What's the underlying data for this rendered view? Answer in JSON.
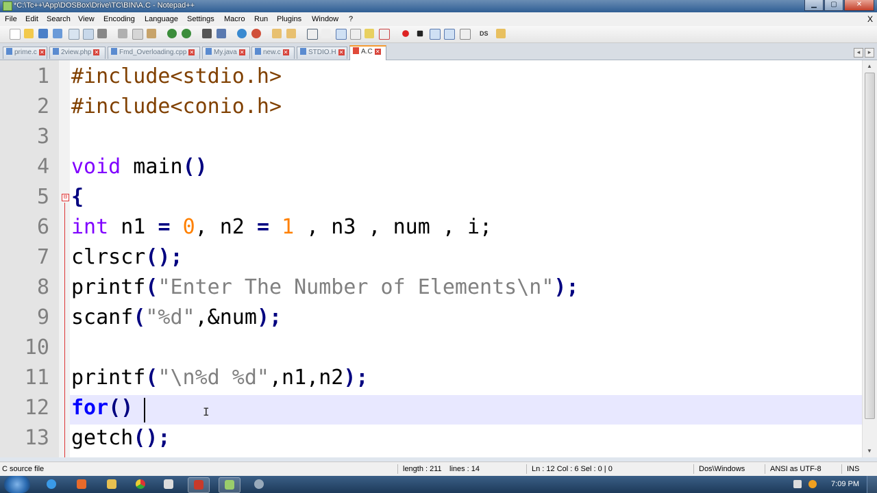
{
  "window": {
    "title": "*C:\\Tc++\\App\\DOSBox\\Drive\\TC\\BIN\\A.C - Notepad++",
    "close_label": "X"
  },
  "menu": [
    {
      "label": "File"
    },
    {
      "label": "Edit"
    },
    {
      "label": "Search"
    },
    {
      "label": "View"
    },
    {
      "label": "Encoding"
    },
    {
      "label": "Language"
    },
    {
      "label": "Settings"
    },
    {
      "label": "Macro"
    },
    {
      "label": "Run"
    },
    {
      "label": "Plugins"
    },
    {
      "label": "Window"
    },
    {
      "label": "?"
    }
  ],
  "toolbar": {
    "icons": [
      "new-file",
      "open-file",
      "save",
      "save-all",
      "close",
      "close-all",
      "print",
      "cut",
      "copy",
      "paste",
      "undo",
      "redo",
      "find",
      "replace",
      "zoom-in",
      "zoom-out",
      "sync-scroll-v",
      "sync-scroll-h",
      "word-wrap",
      "show-all-chars",
      "indent-guide",
      "user-language",
      "doc-map",
      "function-list",
      "record-macro",
      "stop-record",
      "play-macro",
      "play-multiple",
      "save-macro",
      "ds",
      "extra"
    ],
    "ds_label": "DS"
  },
  "tabs": [
    {
      "label": "prime.c",
      "active": false
    },
    {
      "label": "2view.php",
      "active": false
    },
    {
      "label": "Fmd_Overloading.cpp",
      "active": false
    },
    {
      "label": "My.java",
      "active": false
    },
    {
      "label": "new.c",
      "active": false
    },
    {
      "label": "STDIO.H",
      "active": false
    },
    {
      "label": "A.C",
      "active": true
    }
  ],
  "editor": {
    "line_numbers": [
      "1",
      "2",
      "3",
      "4",
      "5",
      "6",
      "7",
      "8",
      "9",
      "10",
      "11",
      "12",
      "13"
    ],
    "fold_marker": "⊟",
    "lines": [
      [
        {
          "t": "#include<stdio.h>",
          "c": "pre"
        }
      ],
      [
        {
          "t": "#include<conio.h>",
          "c": "pre"
        }
      ],
      [],
      [
        {
          "t": "void",
          "c": "kw"
        },
        {
          "t": " main",
          "c": ""
        },
        {
          "t": "()",
          "c": "op"
        }
      ],
      [
        {
          "t": "{",
          "c": "op"
        }
      ],
      [
        {
          "t": "int",
          "c": "kw"
        },
        {
          "t": " n1 ",
          "c": ""
        },
        {
          "t": "=",
          "c": "op"
        },
        {
          "t": " ",
          "c": ""
        },
        {
          "t": "0",
          "c": "num"
        },
        {
          "t": ", n2 ",
          "c": ""
        },
        {
          "t": "=",
          "c": "op"
        },
        {
          "t": " ",
          "c": ""
        },
        {
          "t": "1",
          "c": "num"
        },
        {
          "t": " , n3 , num , i;",
          "c": ""
        }
      ],
      [
        {
          "t": "clrscr",
          "c": ""
        },
        {
          "t": "();",
          "c": "op"
        }
      ],
      [
        {
          "t": "printf",
          "c": ""
        },
        {
          "t": "(",
          "c": "op"
        },
        {
          "t": "\"Enter The Number of Elements\\n\"",
          "c": "str"
        },
        {
          "t": ");",
          "c": "op"
        }
      ],
      [
        {
          "t": "scanf",
          "c": ""
        },
        {
          "t": "(",
          "c": "op"
        },
        {
          "t": "\"%d\"",
          "c": "str"
        },
        {
          "t": ",&num",
          "c": ""
        },
        {
          "t": ");",
          "c": "op"
        }
      ],
      [],
      [
        {
          "t": "printf",
          "c": ""
        },
        {
          "t": "(",
          "c": "op"
        },
        {
          "t": "\"\\n%d %d\"",
          "c": "str"
        },
        {
          "t": ",n1,n2",
          "c": ""
        },
        {
          "t": ");",
          "c": "op"
        }
      ],
      [
        {
          "t": "for",
          "c": "kwb"
        },
        {
          "t": "()",
          "c": "op"
        }
      ],
      [
        {
          "t": "getch",
          "c": ""
        },
        {
          "t": "();",
          "c": "op"
        }
      ]
    ]
  },
  "statusbar": {
    "type": "C source file",
    "length": "length : 211",
    "lines": "lines : 14",
    "position": "Ln : 12    Col : 6    Sel : 0 | 0",
    "eol": "Dos\\Windows",
    "encoding": "ANSI as UTF-8",
    "mode": "INS"
  },
  "taskbar": {
    "clock": "7:09 PM"
  }
}
